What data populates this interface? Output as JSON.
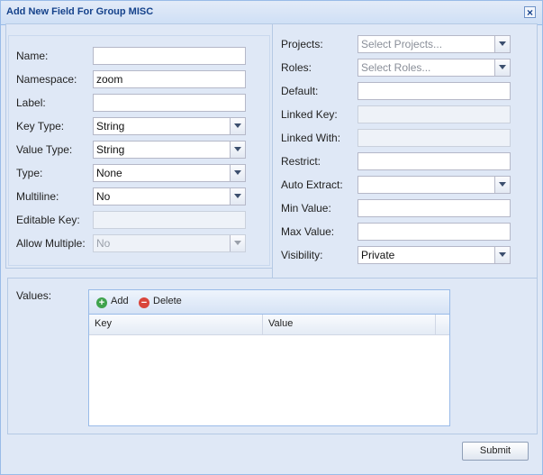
{
  "window": {
    "title": "Add New Field For Group MISC",
    "close_icon": "×"
  },
  "left_fields": [
    {
      "label": "Name:",
      "value": ""
    },
    {
      "label": "Namespace:",
      "value": "zoom"
    },
    {
      "label": "Label:",
      "value": ""
    },
    {
      "label": "Key Type:",
      "value": "String"
    },
    {
      "label": "Value Type:",
      "value": "String"
    },
    {
      "label": "Type:",
      "value": "None"
    },
    {
      "label": "Multiline:",
      "value": "No"
    },
    {
      "label": "Editable Key:",
      "value": ""
    },
    {
      "label": "Allow Multiple:",
      "value": "No"
    }
  ],
  "right_fields": [
    {
      "label": "Projects:",
      "value": "",
      "placeholder": "Select Projects..."
    },
    {
      "label": "Roles:",
      "value": "",
      "placeholder": "Select Roles..."
    },
    {
      "label": "Default:",
      "value": ""
    },
    {
      "label": "Linked Key:",
      "value": ""
    },
    {
      "label": "Linked With:",
      "value": ""
    },
    {
      "label": "Restrict:",
      "value": ""
    },
    {
      "label": "Auto Extract:",
      "value": ""
    },
    {
      "label": "Min Value:",
      "value": ""
    },
    {
      "label": "Max Value:",
      "value": ""
    },
    {
      "label": "Visibility:",
      "value": "Private"
    }
  ],
  "values_section": {
    "label": "Values:",
    "toolbar": {
      "add_label": "Add",
      "delete_label": "Delete"
    },
    "columns": [
      "Key",
      "Value"
    ]
  },
  "footer": {
    "submit_label": "Submit"
  },
  "colors": {
    "title": "#15428b",
    "panel_bg": "#dfe8f6",
    "border": "#99bbe8",
    "add_green": "#3fa34d",
    "delete_red": "#d9453b"
  }
}
